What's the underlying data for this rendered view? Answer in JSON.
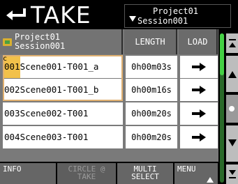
{
  "header": {
    "title": "TAKE",
    "project_line1": "Project01",
    "project_line2": "Session001",
    "back_icon": "return-arrow-icon"
  },
  "table": {
    "headers": {
      "name_line1": "Project01",
      "name_line2": "Session001",
      "length": "LENGTH",
      "load": "LOAD"
    },
    "current_marker": "c",
    "rows": [
      {
        "num": "001",
        "name": "Scene001-T001_a",
        "length": "0h00m03s"
      },
      {
        "num": "002",
        "name": "Scene001-T001_b",
        "length": "0h00m16s"
      },
      {
        "num": "003",
        "name": "Scene002-T001",
        "length": "0h00m20s"
      },
      {
        "num": "004",
        "name": "Scene003-T001",
        "length": "0h00m20s"
      }
    ]
  },
  "footer": {
    "info": "INFO",
    "circle_line1": "CIRCLE @",
    "circle_line2": "TAKE",
    "multi_line1": "MULTI",
    "multi_line2": "SELECT",
    "menu": "MENU"
  },
  "colors": {
    "accent": "#e0b070",
    "scroll": "#44d044",
    "header_bg": "#6b6b6b"
  }
}
